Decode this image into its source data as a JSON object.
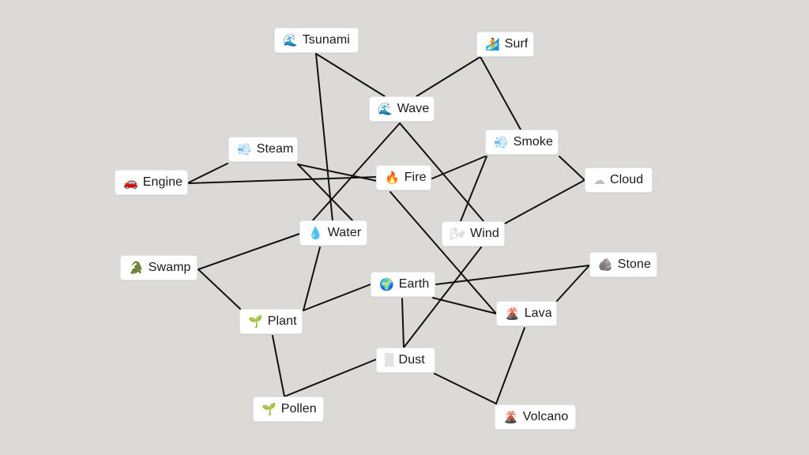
{
  "diagram": {
    "background": "#dcdad6",
    "edge_color": "#111111",
    "nodes": [
      {
        "id": "tsunami",
        "label": "Tsunami",
        "icon": "wave-icon",
        "glyph": "🌊"
      },
      {
        "id": "surf",
        "label": "Surf",
        "icon": "surfer-icon",
        "glyph": "🏄"
      },
      {
        "id": "wave",
        "label": "Wave",
        "icon": "wave-icon",
        "glyph": "🌊"
      },
      {
        "id": "steam",
        "label": "Steam",
        "icon": "steam-cloud-icon",
        "glyph": "💨"
      },
      {
        "id": "smoke",
        "label": "Smoke",
        "icon": "smoke-cloud-icon",
        "glyph": "💨"
      },
      {
        "id": "engine",
        "label": "Engine",
        "icon": "car-icon",
        "glyph": "🚗"
      },
      {
        "id": "fire",
        "label": "Fire",
        "icon": "fire-icon",
        "glyph": "🔥"
      },
      {
        "id": "cloud",
        "label": "Cloud",
        "icon": "cloud-icon",
        "glyph": "☁"
      },
      {
        "id": "water",
        "label": "Water",
        "icon": "droplet-icon",
        "glyph": "💧"
      },
      {
        "id": "wind",
        "label": "Wind",
        "icon": "wind-icon",
        "glyph": "🌬"
      },
      {
        "id": "swamp",
        "label": "Swamp",
        "icon": "swamp-creature-icon",
        "glyph": "🐊"
      },
      {
        "id": "stone",
        "label": "Stone",
        "icon": "rock-icon",
        "glyph": "🪨"
      },
      {
        "id": "earth",
        "label": "Earth",
        "icon": "globe-icon",
        "glyph": "🌍"
      },
      {
        "id": "plant",
        "label": "Plant",
        "icon": "seedling-icon",
        "glyph": "🌱"
      },
      {
        "id": "lava",
        "label": "Lava",
        "icon": "volcano-icon",
        "glyph": "🌋"
      },
      {
        "id": "dust",
        "label": "Dust",
        "icon": "dust-icon",
        "glyph": "▒"
      },
      {
        "id": "pollen",
        "label": "Pollen",
        "icon": "seedling-icon",
        "glyph": "🌱"
      },
      {
        "id": "volcano",
        "label": "Volcano",
        "icon": "volcano-icon",
        "glyph": "🌋"
      }
    ],
    "edges": [
      [
        "tsunami",
        "wave"
      ],
      [
        "tsunami",
        "water"
      ],
      [
        "surf",
        "wave"
      ],
      [
        "surf",
        "smoke"
      ],
      [
        "wave",
        "water"
      ],
      [
        "wave",
        "wind"
      ],
      [
        "steam",
        "engine"
      ],
      [
        "steam",
        "fire"
      ],
      [
        "steam",
        "water"
      ],
      [
        "engine",
        "fire"
      ],
      [
        "fire",
        "smoke"
      ],
      [
        "fire",
        "lava"
      ],
      [
        "smoke",
        "cloud"
      ],
      [
        "smoke",
        "wind"
      ],
      [
        "cloud",
        "wind"
      ],
      [
        "water",
        "swamp"
      ],
      [
        "water",
        "plant"
      ],
      [
        "wind",
        "dust"
      ],
      [
        "swamp",
        "plant"
      ],
      [
        "earth",
        "plant"
      ],
      [
        "earth",
        "stone"
      ],
      [
        "earth",
        "lava"
      ],
      [
        "earth",
        "dust"
      ],
      [
        "stone",
        "lava"
      ],
      [
        "lava",
        "volcano"
      ],
      [
        "plant",
        "pollen"
      ],
      [
        "dust",
        "pollen"
      ],
      [
        "dust",
        "volcano"
      ]
    ]
  }
}
